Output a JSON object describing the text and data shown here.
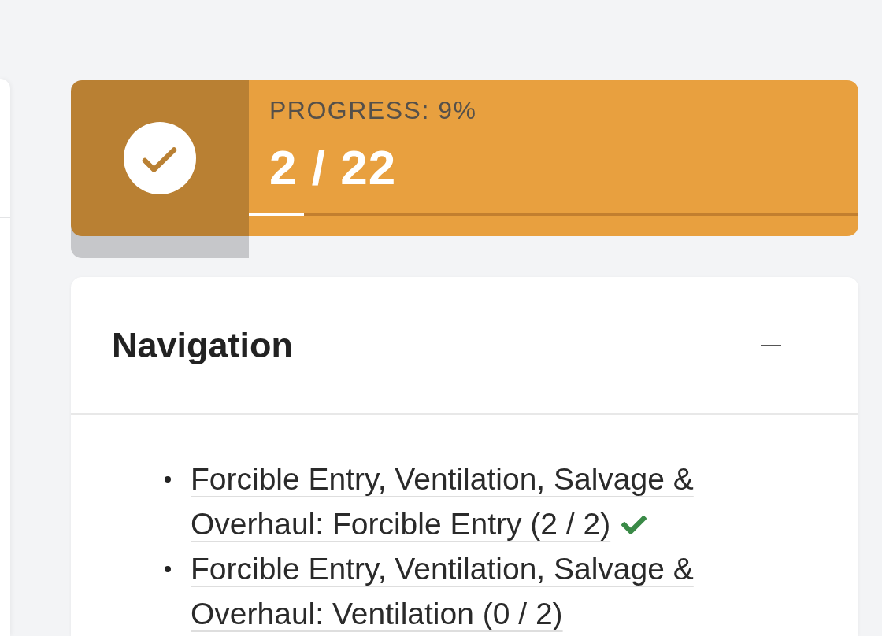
{
  "progress": {
    "label": "PROGRESS: 9%",
    "count": "2 / 22",
    "level": 0.09
  },
  "navigation": {
    "title": "Navigation",
    "expanded": true,
    "items": [
      {
        "label": "Forcible Entry, Ventilation, Salvage & Overhaul: Forcible Entry (2 / 2)",
        "completed": true
      },
      {
        "label": "Forcible Entry, Ventilation, Salvage & Overhaul: Ventilation (0 / 2)",
        "completed": false
      }
    ]
  }
}
